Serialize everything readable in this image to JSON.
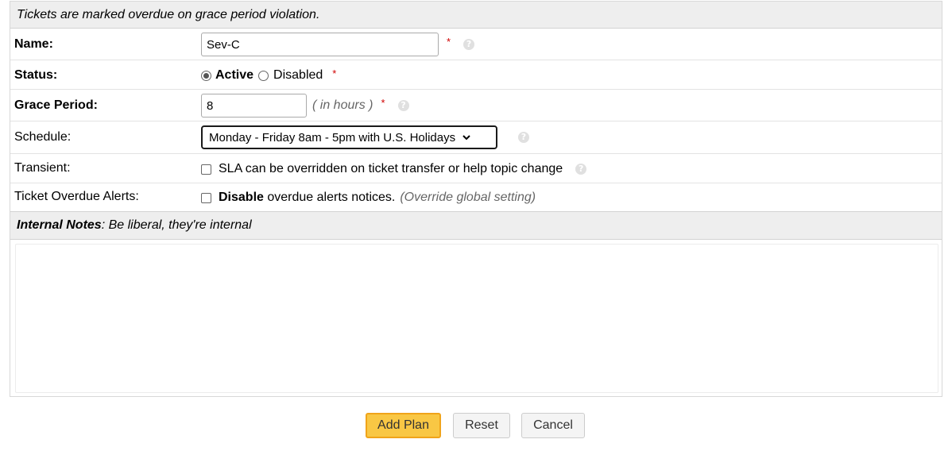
{
  "header_note": "Tickets are marked overdue on grace period violation.",
  "fields": {
    "name": {
      "label": "Name:",
      "value": "Sev-C",
      "required": "*"
    },
    "status": {
      "label": "Status:",
      "active_label": "Active",
      "disabled_label": "Disabled",
      "required": "*",
      "selected": "Active"
    },
    "grace_period": {
      "label": "Grace Period:",
      "value": "8",
      "hint": "( in hours )",
      "required": "*"
    },
    "schedule": {
      "label": "Schedule:",
      "selected": "Monday - Friday 8am - 5pm with U.S. Holidays"
    },
    "transient": {
      "label": "Transient:",
      "checkbox_text": "SLA can be overridden on ticket transfer or help topic change",
      "checked": false
    },
    "overdue_alerts": {
      "label": "Ticket Overdue Alerts:",
      "bold_text": "Disable",
      "text": " overdue alerts notices.",
      "hint": "(Override global setting)",
      "checked": false
    }
  },
  "internal_notes": {
    "bold_label": "Internal Notes",
    "text": ": Be liberal, they're internal"
  },
  "buttons": {
    "add": "Add Plan",
    "reset": "Reset",
    "cancel": "Cancel"
  },
  "colors": {
    "primary_button": "#f9c744",
    "required_marker": "#d00000",
    "header_bg": "#eeeeee"
  },
  "icons": {
    "help": "help-icon",
    "dropdown": "chevron-down-icon"
  }
}
